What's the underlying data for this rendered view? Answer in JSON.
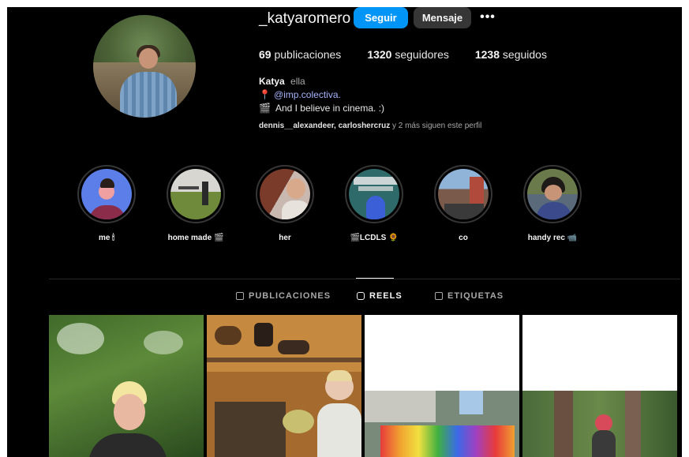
{
  "profile": {
    "username": "_katyaromero",
    "follow_label": "Seguir",
    "message_label": "Mensaje",
    "more_label": "•••",
    "stats": [
      {
        "count": "69",
        "label": "publicaciones"
      },
      {
        "count": "1320",
        "label": "seguidores"
      },
      {
        "count": "1238",
        "label": "seguidos"
      }
    ],
    "bio": {
      "name": "Katya",
      "pronouns": "ella",
      "pin_icon": "📍",
      "link": "@imp.colectiva.",
      "clapper_icon": "🎬",
      "line": "And I believe in cinema. :)"
    },
    "followed_by": {
      "names": "dennis__alexandeer, carloshercruz",
      "rest": " y 2 más siguen este perfil"
    }
  },
  "highlights": [
    {
      "label": "me 🕯"
    },
    {
      "label": "home made 🎬"
    },
    {
      "label": "her"
    },
    {
      "label": "🎬LCDLS 🌻"
    },
    {
      "label": "co"
    },
    {
      "label": "handy rec 📹"
    }
  ],
  "tabs": [
    {
      "label": "PUBLICACIONES",
      "active": false
    },
    {
      "label": "REELS",
      "active": true
    },
    {
      "label": "ETIQUETAS",
      "active": false
    }
  ],
  "colors": {
    "accent": "#0095f6",
    "background": "#000000",
    "secondary_button": "#363636"
  }
}
